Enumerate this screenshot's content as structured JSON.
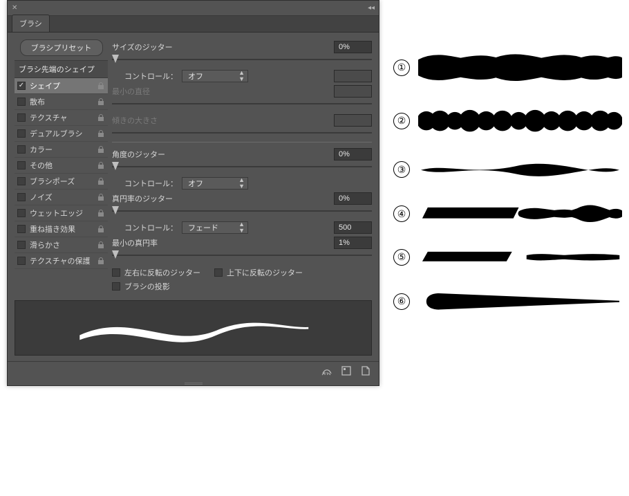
{
  "panel": {
    "title": "ブラシ",
    "preset_button": "ブラシプリセット",
    "tip_shape_header": "ブラシ先端のシェイプ",
    "sidebar_items": [
      {
        "label": "シェイプ",
        "checked": true,
        "selected": true,
        "lock": true
      },
      {
        "label": "散布",
        "checked": false,
        "selected": false,
        "lock": true
      },
      {
        "label": "テクスチャ",
        "checked": false,
        "selected": false,
        "lock": true
      },
      {
        "label": "デュアルブラシ",
        "checked": false,
        "selected": false,
        "lock": true
      },
      {
        "label": "カラー",
        "checked": false,
        "selected": false,
        "lock": true
      },
      {
        "label": "その他",
        "checked": false,
        "selected": false,
        "lock": true
      },
      {
        "label": "ブラシポーズ",
        "checked": false,
        "selected": false,
        "lock": true
      },
      {
        "label": "ノイズ",
        "checked": false,
        "selected": false,
        "lock": true
      },
      {
        "label": "ウェットエッジ",
        "checked": false,
        "selected": false,
        "lock": true
      },
      {
        "label": "重ね描き効果",
        "checked": false,
        "selected": false,
        "lock": true
      },
      {
        "label": "滑らかさ",
        "checked": false,
        "selected": false,
        "lock": true
      },
      {
        "label": "テクスチャの保護",
        "checked": false,
        "selected": false,
        "lock": true
      }
    ]
  },
  "controls": {
    "size_jitter_label": "サイズのジッター",
    "size_jitter_value": "0%",
    "size_jitter_pos": 0,
    "size_control_label": "コントロール：",
    "size_control_value": "オフ",
    "min_diameter_label": "最小の直径",
    "tilt_scale_label": "傾きの大きさ",
    "angle_jitter_label": "角度のジッター",
    "angle_jitter_value": "0%",
    "angle_jitter_pos": 0,
    "angle_control_label": "コントロール：",
    "angle_control_value": "オフ",
    "round_jitter_label": "真円率のジッター",
    "round_jitter_value": "0%",
    "round_jitter_pos": 0,
    "round_control_label": "コントロール：",
    "round_control_value": "フェード",
    "round_control_steps": "500",
    "min_round_label": "最小の真円率",
    "min_round_value": "1%",
    "min_round_pos": 0,
    "flip_x_label": "左右に反転のジッター",
    "flip_y_label": "上下に反転のジッター",
    "projection_label": "ブラシの投影"
  },
  "demos": [
    {
      "num": "①"
    },
    {
      "num": "②"
    },
    {
      "num": "③"
    },
    {
      "num": "④"
    },
    {
      "num": "⑤"
    },
    {
      "num": "⑥"
    }
  ]
}
